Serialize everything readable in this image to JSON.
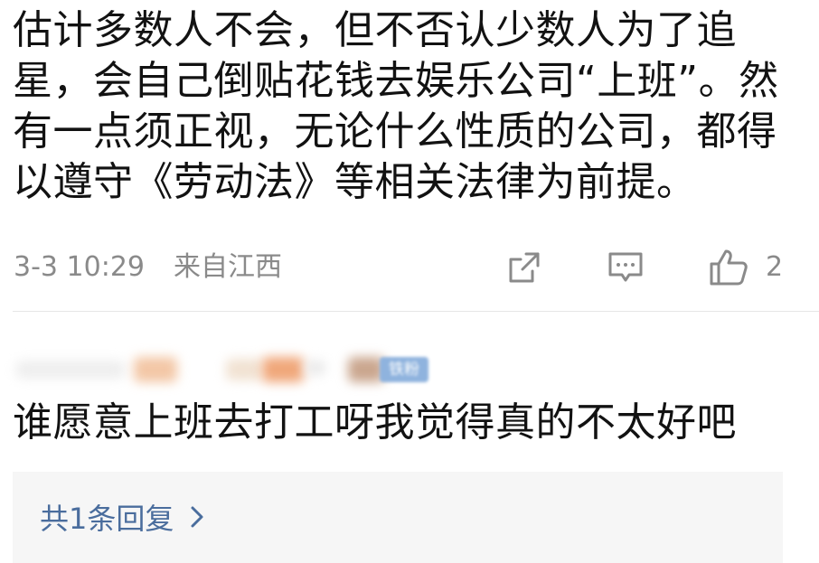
{
  "comment_1": {
    "text": "估计多数人不会，但不否认少数人为了追星，会自己倒贴花钱去娱乐公司“上班”。然有一点须正视，无论什么性质的公司，都得以遵守《劳动法》等相关法律为前提。",
    "time": "3-3 10:29",
    "location": "来自江西",
    "like_count": "2",
    "icons": {
      "share": "share-icon",
      "comment": "comment-icon",
      "like": "thumbs-up-icon"
    }
  },
  "comment_2": {
    "badge": "铁粉",
    "text": "谁愿意上班去打工呀我觉得真的不太好吧",
    "reply_link": "共1条回复",
    "reply_icon": "chevron-right-icon"
  },
  "colors": {
    "text": "#121212",
    "meta": "#8a8a8a",
    "link": "#4a6d9d",
    "reply_bg": "#f6f6f6",
    "badge_bg": "#8fb3de"
  }
}
